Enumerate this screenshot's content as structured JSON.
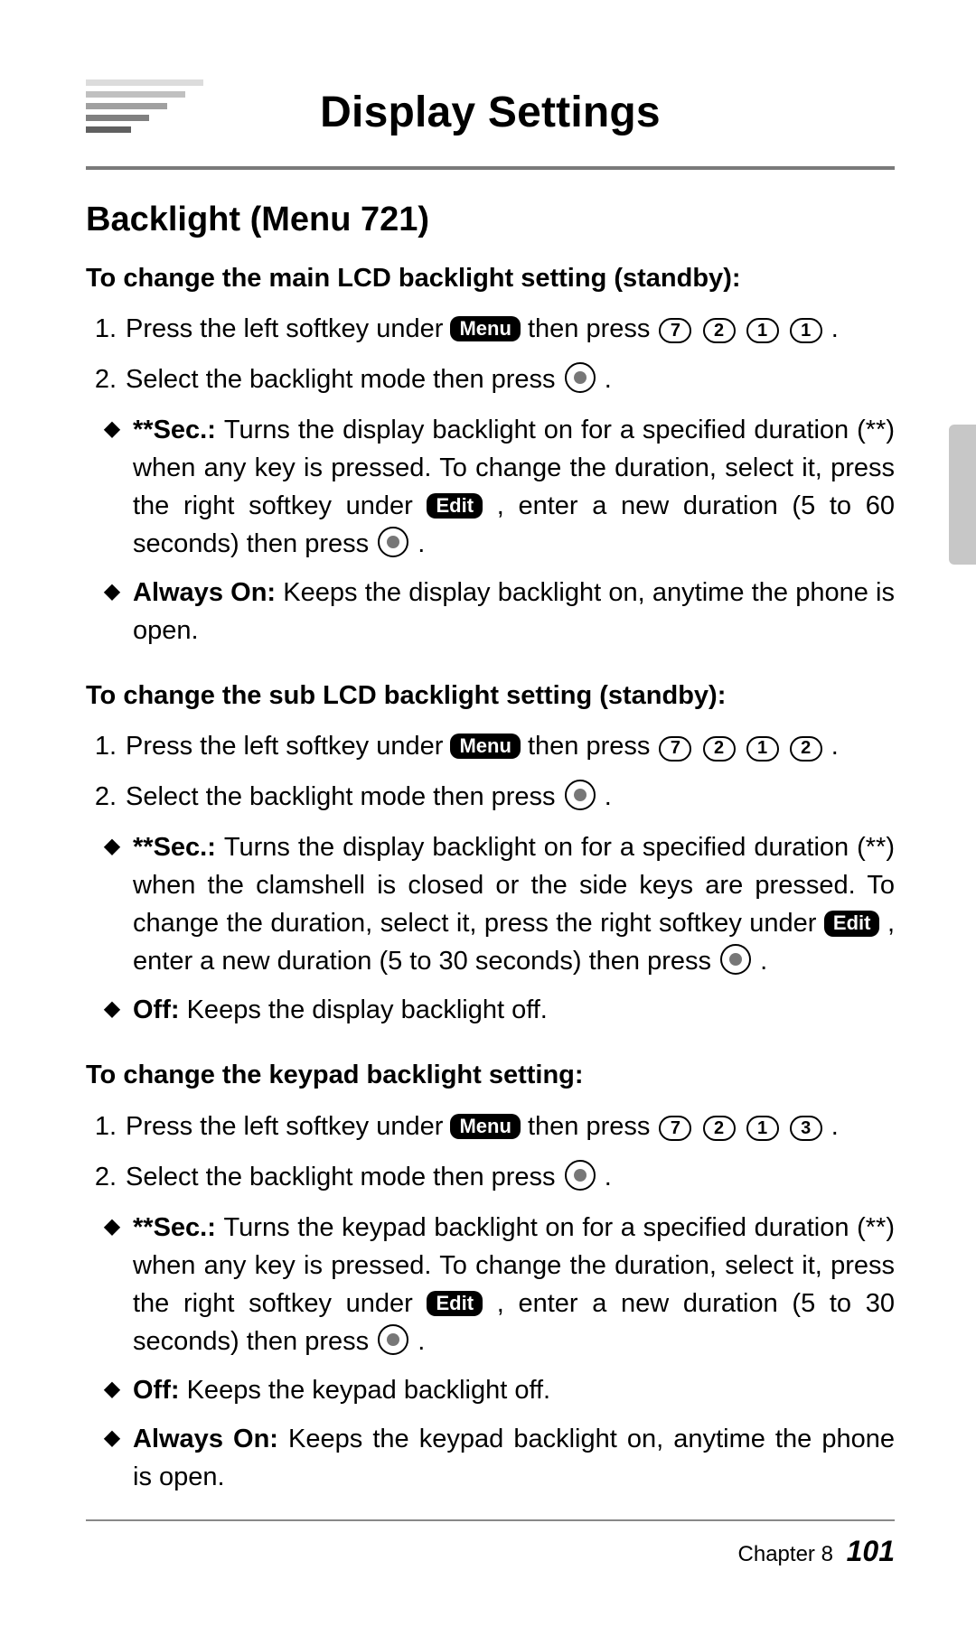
{
  "title": "Display Settings",
  "section": "Backlight (Menu 721)",
  "labels": {
    "menu": "Menu",
    "edit": "Edit"
  },
  "footer": {
    "chapter": "Chapter 8",
    "page": "101"
  },
  "mainLCD": {
    "heading": "To change the main LCD backlight setting (standby):",
    "step1a": "Press the left softkey under ",
    "step1b": " then press ",
    "step1keys": [
      "7",
      "2",
      "1",
      "1"
    ],
    "step1c": ".",
    "step2a": "Select the backlight mode then press ",
    "step2b": ".",
    "secLabel": "**Sec.: ",
    "sec1": "Turns the display backlight on for a specified duration (**) when any key is pressed. To change the duration, select it, press the right softkey under ",
    "sec2": ", enter a new duration (5 to 60 seconds) then press ",
    "sec3": ".",
    "alwaysLabel": "Always On: ",
    "always": "Keeps the display backlight on, anytime the phone is open."
  },
  "subLCD": {
    "heading": "To change the sub LCD backlight setting (standby):",
    "step1a": "Press the left softkey under ",
    "step1b": " then press ",
    "step1keys": [
      "7",
      "2",
      "1",
      "2"
    ],
    "step1c": ".",
    "step2a": "Select the backlight mode then press ",
    "step2b": ".",
    "secLabel": "**Sec.: ",
    "sec1": "Turns the display backlight on for a specified duration (**) when the clamshell is closed or the side keys are pressed. To change the duration, select it, press the right softkey under ",
    "sec2": ", enter a new duration (5 to 30 seconds) then press ",
    "sec3": ".",
    "offLabel": "Off: ",
    "off": "Keeps the display backlight off."
  },
  "keypad": {
    "heading": "To change the keypad backlight setting:",
    "step1a": "Press the left softkey under ",
    "step1b": " then press ",
    "step1keys": [
      "7",
      "2",
      "1",
      "3"
    ],
    "step1c": ".",
    "step2a": "Select the backlight mode then press ",
    "step2b": ".",
    "secLabel": "**Sec.: ",
    "sec1": "Turns the keypad backlight on for a specified duration (**) when any key is pressed. To change the duration, select it, press the right softkey under ",
    "sec2": ", enter a new duration (5 to 30 seconds) then press ",
    "sec3": ".",
    "offLabel": "Off: ",
    "off": "Keeps the keypad backlight off.",
    "alwaysLabel": "Always On: ",
    "always": "Keeps the keypad backlight on, anytime the phone is open."
  }
}
